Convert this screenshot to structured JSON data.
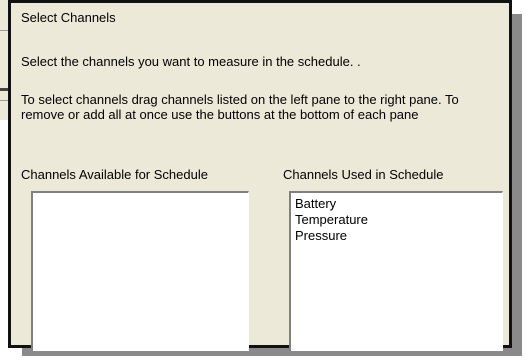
{
  "dialog": {
    "heading": "Select Channels",
    "instruction": "Select the channels you want to measure in the schedule. .",
    "description": "To select channels drag channels listed on the left pane to the right pane. To remove or add all at once use the buttons at the bottom of each pane"
  },
  "available_pane": {
    "label": "Channels Available for Schedule",
    "items": []
  },
  "used_pane": {
    "label": "Channels Used in Schedule",
    "items": [
      "Battery",
      "Temperature",
      "Pressure"
    ]
  }
}
